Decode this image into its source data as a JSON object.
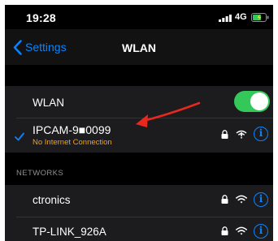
{
  "status_bar": {
    "time": "19:28",
    "network_type": "4G",
    "signal_icon": "cellular-signal-icon",
    "battery_icon": "battery-charging-icon"
  },
  "nav": {
    "back_label": "Settings",
    "title": "WLAN"
  },
  "wlan_toggle": {
    "label": "WLAN",
    "on": true,
    "on_color": "#34c759"
  },
  "connected_network": {
    "name": "IPCAM-9■0099",
    "status": "No Internet Connection",
    "status_color": "#ff9f0a",
    "icons": [
      "lock-icon",
      "wifi-no-internet-icon",
      "info-icon"
    ]
  },
  "networks_header": "NETWORKS",
  "networks": [
    {
      "name": "ctronics",
      "icons": [
        "lock-icon",
        "wifi-icon",
        "info-icon"
      ]
    },
    {
      "name": "TP-LINK_926A",
      "icons": [
        "lock-icon",
        "wifi-icon",
        "info-icon"
      ]
    }
  ],
  "info_glyph": "i",
  "annotation": {
    "type": "red-arrow",
    "color": "#e8281f"
  },
  "accent_color": "#0a84ff"
}
